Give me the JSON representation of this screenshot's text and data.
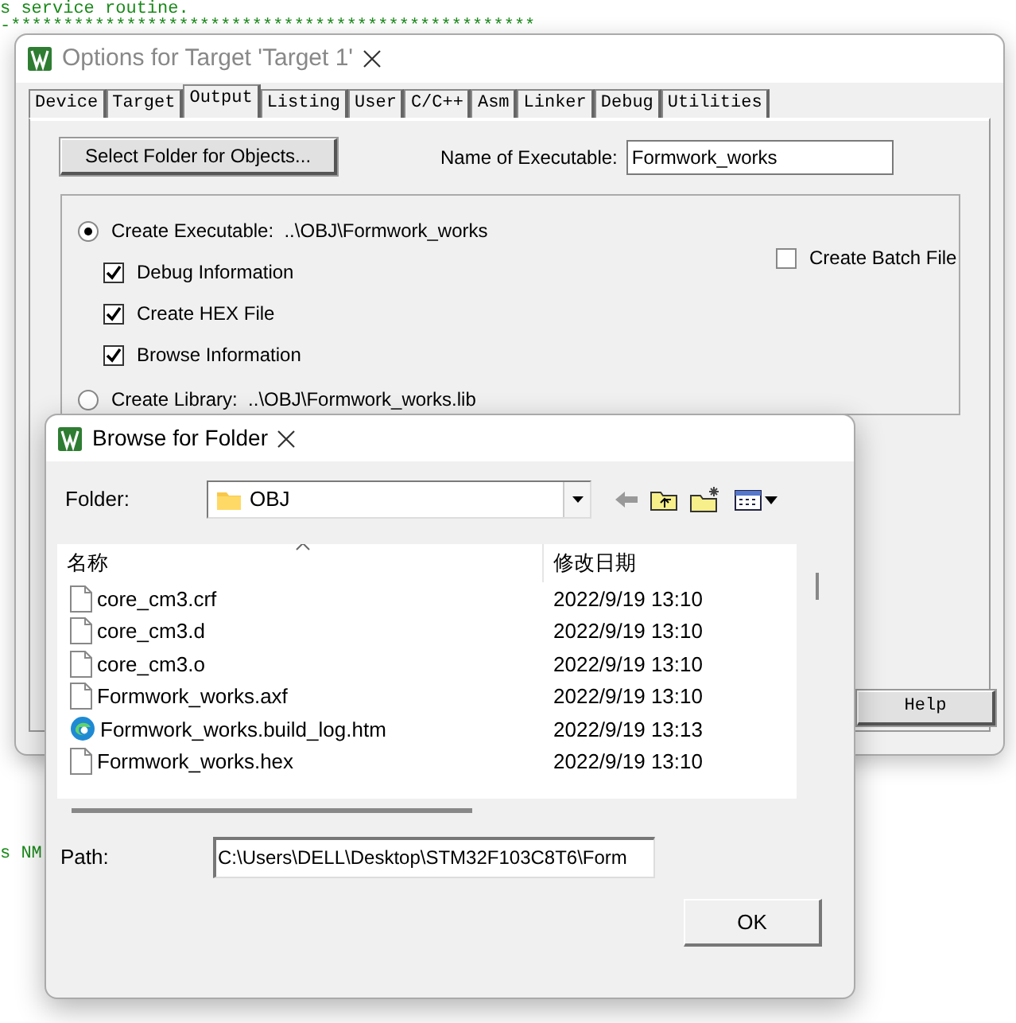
{
  "background_editor": {
    "top_lines": [
      "s service routine.",
      "-**************************************************"
    ],
    "bottom_line": "s NM"
  },
  "options_window": {
    "title": "Options for Target 'Target 1'",
    "tabs": [
      {
        "label": "Device",
        "selected": false
      },
      {
        "label": "Target",
        "selected": false
      },
      {
        "label": "Output",
        "selected": true
      },
      {
        "label": "Listing",
        "selected": false
      },
      {
        "label": "User",
        "selected": false
      },
      {
        "label": "C/C++",
        "selected": false
      },
      {
        "label": "Asm",
        "selected": false
      },
      {
        "label": "Linker",
        "selected": false
      },
      {
        "label": "Debug",
        "selected": false
      },
      {
        "label": "Utilities",
        "selected": false
      }
    ],
    "select_folder_button": "Select Folder for Objects...",
    "name_of_executable": {
      "label": "Name of Executable:",
      "value": "Formwork_works"
    },
    "output_options": [
      {
        "kind": "radio",
        "label": "Create Executable:  ..\\OBJ\\Formwork_works",
        "selected": true
      },
      {
        "kind": "checkbox",
        "label": "Debug Information",
        "checked": true
      },
      {
        "kind": "checkbox",
        "label": "Create HEX File",
        "checked": true
      },
      {
        "kind": "checkbox",
        "label": "Browse Information",
        "checked": true
      },
      {
        "kind": "radio",
        "label": "Create Library:  ..\\OBJ\\Formwork_works.lib",
        "selected": false
      }
    ],
    "create_batch_file": {
      "label": "Create Batch File",
      "checked": false
    },
    "help_button": "Help"
  },
  "browse_dialog": {
    "title": "Browse for Folder",
    "folder": {
      "label": "Folder:",
      "value": "OBJ"
    },
    "columns": [
      "名称",
      "修改日期"
    ],
    "files": [
      {
        "kind": "file",
        "name": "core_cm3.crf",
        "modified": "2022/9/19 13:10"
      },
      {
        "kind": "file",
        "name": "core_cm3.d",
        "modified": "2022/9/19 13:10"
      },
      {
        "kind": "file",
        "name": "core_cm3.o",
        "modified": "2022/9/19 13:10"
      },
      {
        "kind": "file",
        "name": "Formwork_works.axf",
        "modified": "2022/9/19 13:10"
      },
      {
        "kind": "web",
        "name": "Formwork_works.build_log.htm",
        "modified": "2022/9/19 13:13"
      },
      {
        "kind": "file",
        "name": "Formwork_works.hex",
        "modified": "2022/9/19 13:10"
      }
    ],
    "path": {
      "label": "Path:",
      "value": "C:\\Users\\DELL\\Desktop\\STM32F103C8T6\\Form"
    },
    "ok_button": "OK"
  }
}
